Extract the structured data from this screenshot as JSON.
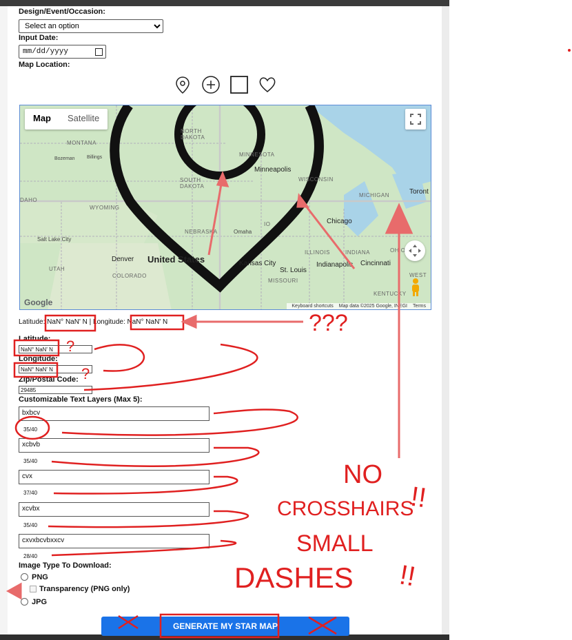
{
  "form": {
    "design_label": "Design/Event/Occasion:",
    "design_selected": "Select an option",
    "date_label": "Input Date:",
    "date_placeholder": "mm/dd/yyyy",
    "map_location_label": "Map Location:",
    "marker_tools": [
      "pin-icon",
      "crosshair-plus-icon",
      "square-icon",
      "heart-icon"
    ],
    "coord_line": {
      "lat_label": "Latitude: ",
      "lat_value": "NaN° NaN' N",
      "separator": " | ",
      "lng_label": "Longitude: ",
      "lng_value": "NaN° NaN' N"
    },
    "latitude_label": "Latitude:",
    "latitude_value": "NaN° NaN' N",
    "longitude_label": "Longitude:",
    "longitude_value": "NaN° NaN' N",
    "zip_label": "Zip/Postal Code:",
    "zip_value": "29485",
    "text_layers_label": "Customizable Text Layers (Max 5):",
    "text_layers": [
      {
        "value": "bxbcv",
        "count": "35/40"
      },
      {
        "value": "xcbvb",
        "count": "35/40"
      },
      {
        "value": "cvx",
        "count": "37/40"
      },
      {
        "value": "xcvbx",
        "count": "35/40"
      },
      {
        "value": "cxvxbcvbxxcv",
        "count": "28/40"
      }
    ],
    "image_type_label": "Image Type To Download:",
    "options": {
      "png": "PNG",
      "transparency": "Transparency (PNG only)",
      "jpg": "JPG"
    },
    "generate_label": "GENERATE MY STAR MAP"
  },
  "map": {
    "types": [
      "Map",
      "Satellite"
    ],
    "active_type": "Map",
    "labels": {
      "north_dakota": "NORTH\nDAKOTA",
      "montana": "MONTANA",
      "bozeman": "Bozeman",
      "billings": "Billings",
      "minnesota": "MINNESOTA",
      "minneapolis": "Minneapolis",
      "south_dakota": "SOUTH\nDAKOTA",
      "wisconsin": "WISCONSIN",
      "michigan": "MICHIGAN",
      "toronto": "Toront",
      "idaho": "DAHO",
      "wyoming": "WYOMING",
      "chicago": "Chicago",
      "nebraska": "NEBRASKA",
      "omaha": "Omaha",
      "iowa": "IO",
      "salt_lake_city": "Salt Lake City",
      "illinois": "ILLINOIS",
      "indiana": "INDIANA",
      "ohio": "OHIO",
      "utah": "UTAH",
      "denver": "Denver",
      "united_states": "United States",
      "kansas_city": "Kansas City",
      "indianapolis": "Indianapolis",
      "cincinnati": "Cincinnati",
      "colorado": "COLORADO",
      "st_louis": "St. Louis",
      "missouri": "MISSOURI",
      "west": "WEST",
      "kentucky": "KENTUCKY"
    },
    "google": "Google",
    "attribution": [
      "Keyboard shortcuts",
      "Map data ©2025 Google, INEGI",
      "Terms"
    ]
  },
  "annotations": {
    "question_marks": "???",
    "small_q1": "?",
    "small_q2": "?",
    "no_crosshairs_1": "NO",
    "no_crosshairs_2": "CROSSHAIRS",
    "small_dashes_1": "SMALL",
    "small_dashes_2": "DASHES",
    "color": "#e02020"
  }
}
